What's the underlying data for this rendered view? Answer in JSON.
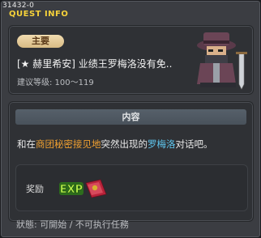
{
  "window": {
    "quest_id": "31432-0",
    "header": "QUEST INFO"
  },
  "summary": {
    "badge": "主要",
    "title": "[★ 赫里希安] 业绩王罗梅洛没有免..",
    "level": "建议等级: 100～119",
    "npc_icon": "masked-npc-portrait"
  },
  "content": {
    "section_title": "内容",
    "desc_pre": "和在",
    "desc_hl1": "商团秘密接见地",
    "desc_mid": "突然出现的",
    "desc_hl2": "罗梅洛",
    "desc_post": "对话吧。",
    "reward_label": "奖励",
    "reward_icons": [
      "exp-icon",
      "scroll-envelope-icon"
    ]
  },
  "footer": {
    "status": "狀態: 可開始 / 不可执行任務"
  },
  "colors": {
    "header_yellow": "#f6d23a",
    "highlight_orange": "#f0a030",
    "highlight_blue": "#5fc7f0"
  }
}
